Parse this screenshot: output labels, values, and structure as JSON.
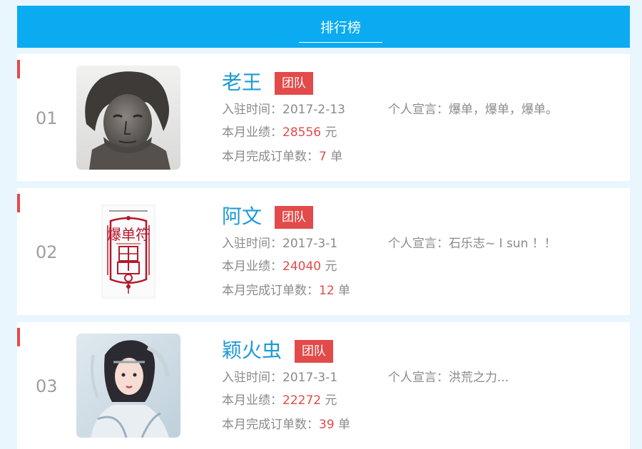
{
  "header": {
    "title": "排行榜"
  },
  "labels": {
    "join_prefix": "入驻时间：",
    "motto_prefix": "个人宣言：",
    "sales_prefix": "本月业绩：",
    "sales_unit": " 元",
    "orders_prefix": "本月完成订单数：",
    "orders_unit": " 单"
  },
  "ranking": [
    {
      "rank": "01",
      "name": "老王",
      "tag": "团队",
      "join_date": "2017-2-13",
      "motto": "爆单，爆单，爆单。",
      "sales": "28556",
      "orders": "7",
      "avatar": "bronze-bust-photo"
    },
    {
      "rank": "02",
      "name": "阿文",
      "tag": "团队",
      "join_date": "2017-3-1",
      "motto": "石乐志~ I sun ！！",
      "sales": "24040",
      "orders": "12",
      "avatar": "book-cover-talisman",
      "avatar_text": "爆单符"
    },
    {
      "rank": "03",
      "name": "颖火虫",
      "tag": "团队",
      "join_date": "2017-3-1",
      "motto": "洪荒之力...",
      "sales": "22272",
      "orders": "39",
      "avatar": "fantasy-heroine-illustration"
    }
  ],
  "colors": {
    "header": "#0aabf1",
    "accent_red": "#e34a4a",
    "name_blue": "#1c9ad6",
    "background": "#eaf6fd"
  }
}
